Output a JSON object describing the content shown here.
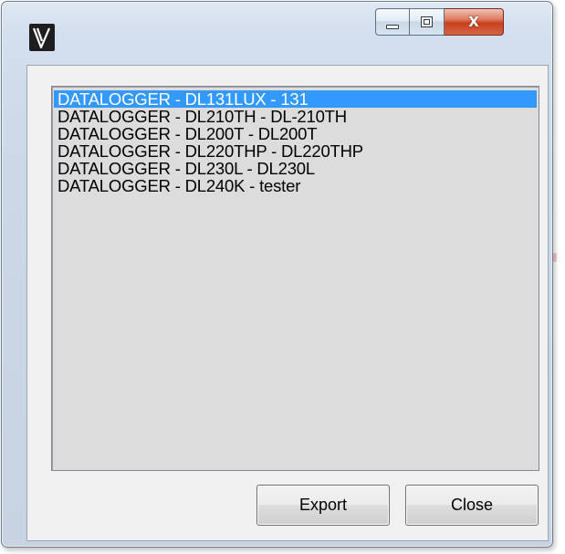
{
  "window": {
    "icon": "v-logo-icon",
    "caption_buttons": {
      "minimize": "minimize-icon",
      "maximize": "maximize-icon",
      "close": "X"
    }
  },
  "list": {
    "selected_index": 0,
    "items": [
      "DATALOGGER - DL131LUX - 131",
      "DATALOGGER - DL210TH - DL-210TH",
      "DATALOGGER - DL200T - DL200T",
      "DATALOGGER - DL220THP - DL220THP",
      "DATALOGGER - DL230L - DL230L",
      "DATALOGGER - DL240K - tester"
    ]
  },
  "buttons": {
    "export_label": "Export",
    "close_label": "Close"
  },
  "colors": {
    "selection": "#3399ff",
    "close_button": "#c8401f",
    "list_background": "#dcdcdc"
  }
}
